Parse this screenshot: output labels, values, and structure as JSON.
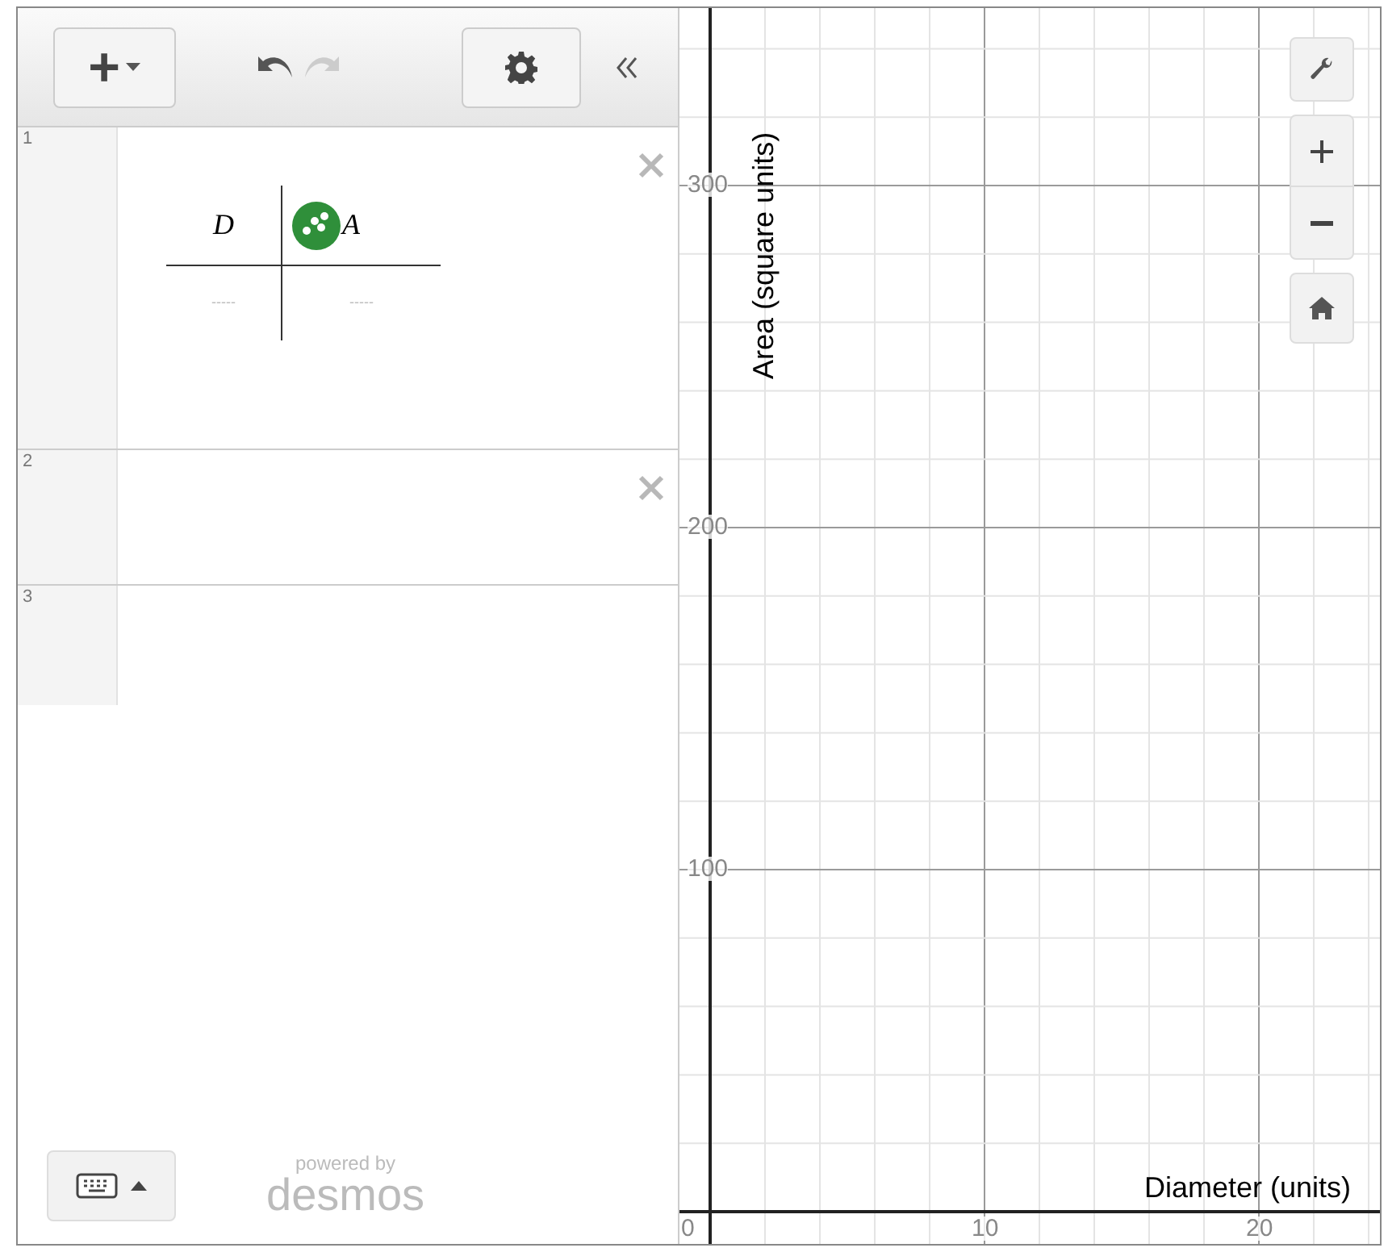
{
  "toolbar": {
    "add_label": "+"
  },
  "expressions": [
    {
      "kind": "table",
      "number": "1",
      "columns": [
        {
          "header": "D",
          "placeholder": "-----"
        },
        {
          "header": "A",
          "placeholder": "-----"
        }
      ]
    },
    {
      "kind": "empty",
      "number": "2"
    },
    {
      "kind": "new",
      "number": "3"
    }
  ],
  "branding": {
    "line1": "powered by",
    "line2": "desmos"
  },
  "graph": {
    "x_axis_label": "Diameter (units)",
    "y_axis_label": "Area (square units)",
    "x_ticks": [
      "0",
      "10",
      "20"
    ],
    "y_ticks": [
      "300",
      "200",
      "100"
    ]
  }
}
